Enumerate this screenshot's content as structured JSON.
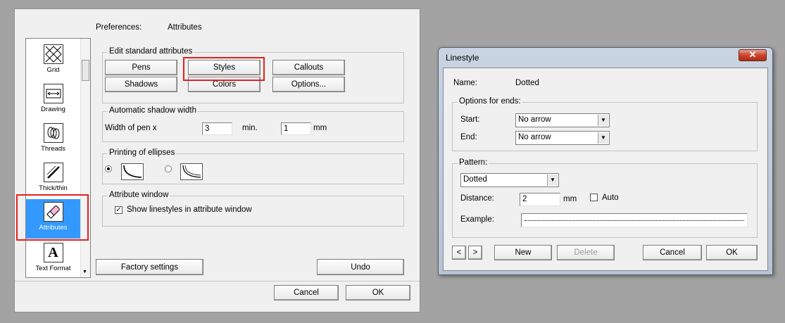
{
  "preferences": {
    "header_left": "Preferences:",
    "header_right": "Attributes",
    "sidebar": {
      "items": [
        {
          "label": "Grid",
          "icon": "grid-icon"
        },
        {
          "label": "Drawing",
          "icon": "drawing-icon"
        },
        {
          "label": "Threads",
          "icon": "threads-icon"
        },
        {
          "label": "Thick/thin",
          "icon": "thick-thin-icon"
        },
        {
          "label": "Attributes",
          "icon": "attributes-icon",
          "selected": true
        },
        {
          "label": "Text Format",
          "icon": "text-format-icon"
        }
      ]
    },
    "edit_group": {
      "title": "Edit standard attributes",
      "pens": "Pens",
      "styles": "Styles",
      "callouts": "Callouts",
      "shadows": "Shadows",
      "colors": "Colors",
      "options": "Options..."
    },
    "shadow_group": {
      "title": "Automatic shadow width",
      "width_label": "Width of pen x",
      "width_value": "3",
      "min_label": "min.",
      "min_value": "1",
      "unit": "mm"
    },
    "ellipse_group": {
      "title": "Printing of ellipses"
    },
    "attr_window_group": {
      "title": "Attribute window",
      "checkbox_label": "Show linestyles in attribute window",
      "checked": true
    },
    "factory_settings": "Factory settings",
    "undo": "Undo",
    "cancel": "Cancel",
    "ok": "OK"
  },
  "linestyle": {
    "title": "Linestyle",
    "close": "✕",
    "name_label": "Name:",
    "name_value": "Dotted",
    "ends_group": {
      "title": "Options for ends:",
      "start_label": "Start:",
      "start_value": "No arrow",
      "end_label": "End:",
      "end_value": "No arrow"
    },
    "pattern_group": {
      "title": "Pattern:",
      "pattern_value": "Dotted",
      "distance_label": "Distance:",
      "distance_value": "2",
      "distance_unit": "mm",
      "auto_label": "Auto",
      "example_label": "Example:"
    },
    "prev": "<",
    "next": ">",
    "new": "New",
    "delete": "Delete",
    "cancel": "Cancel",
    "ok": "OK"
  },
  "colors": {
    "highlight": "#e4201f",
    "selection": "#3399ff"
  }
}
